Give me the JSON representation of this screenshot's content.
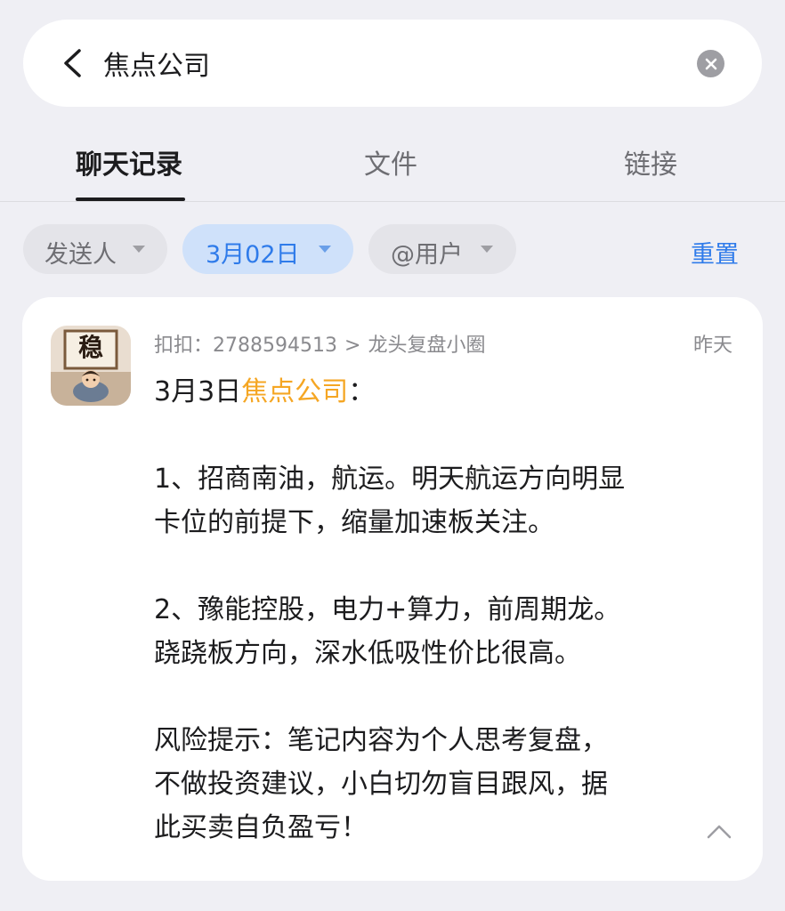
{
  "search": {
    "value": "焦点公司",
    "back_icon": "chevron-left-icon",
    "clear_icon": "clear-circle-icon"
  },
  "tabs": [
    {
      "label": "聊天记录",
      "active": true
    },
    {
      "label": "文件",
      "active": false
    },
    {
      "label": "链接",
      "active": false
    }
  ],
  "filters": {
    "sender": {
      "label": "发送人",
      "selected": false
    },
    "date": {
      "label": "3月02日",
      "selected": true
    },
    "mention": {
      "label": "@用户",
      "selected": false
    },
    "reset_label": "重置"
  },
  "message": {
    "avatar_char": "稳",
    "source_prefix": "扣扣：",
    "source_id": "2788594513",
    "source_separator": ">",
    "group_name": "龙头复盘小圈",
    "time": "昨天",
    "line1_prefix": "3月3日",
    "line1_keyword": "焦点公司",
    "line1_suffix": "：",
    "lines": [
      "1、招商南油，航运。明天航运方向明显",
      "卡位的前提下，缩量加速板关注。",
      "2、豫能控股，电力+算力，前周期龙。",
      "跷跷板方向，深水低吸性价比很高。",
      "风险提示：笔记内容为个人思考复盘，",
      "不做投资建议，小白切勿盲目跟风，据",
      "此买卖自负盈亏！"
    ]
  },
  "colors": {
    "accent": "#2f7bea",
    "highlight": "#f5a623",
    "background": "#efeff4",
    "card": "#ffffff",
    "selected_chip_bg": "#cfe1fa"
  }
}
